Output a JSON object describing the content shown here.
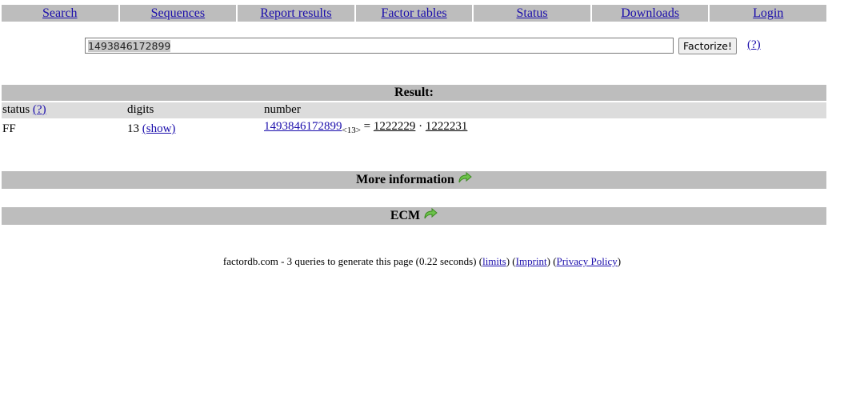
{
  "nav": {
    "items": [
      {
        "label": "Search"
      },
      {
        "label": "Sequences"
      },
      {
        "label": "Report results"
      },
      {
        "label": "Factor tables"
      },
      {
        "label": "Status"
      },
      {
        "label": "Downloads"
      },
      {
        "label": "Login"
      }
    ]
  },
  "search": {
    "value": "1493846172899",
    "button_label": "Factorize!",
    "help_label": "(?)"
  },
  "result": {
    "heading": "Result:",
    "columns": {
      "status": "status",
      "status_help": "(?)",
      "digits": "digits",
      "number": "number"
    },
    "row": {
      "status": "FF",
      "digits": "13",
      "show_label": "(show)",
      "number": "1493846172899",
      "number_subscript": "<13>",
      "equals": "=",
      "factor1": "1222229",
      "dot": "·",
      "factor2": "1222231"
    }
  },
  "sections": {
    "more_information": "More information",
    "ecm": "ECM"
  },
  "footer": {
    "text_before": "factordb.com - 3 queries to generate this page (0.22 seconds) (",
    "limits": "limits",
    "between1": ") (",
    "imprint": "Imprint",
    "between2": ") (",
    "privacy": "Privacy Policy",
    "after": ")"
  },
  "colors": {
    "bar_gray": "#bdbdbd",
    "header_gray": "#dcdcdc",
    "link_blue": "#1a0dab",
    "arrow_green": "#6cc24a"
  },
  "icons": {
    "more_information": "green-curved-arrow-icon",
    "ecm": "green-curved-arrow-icon"
  }
}
